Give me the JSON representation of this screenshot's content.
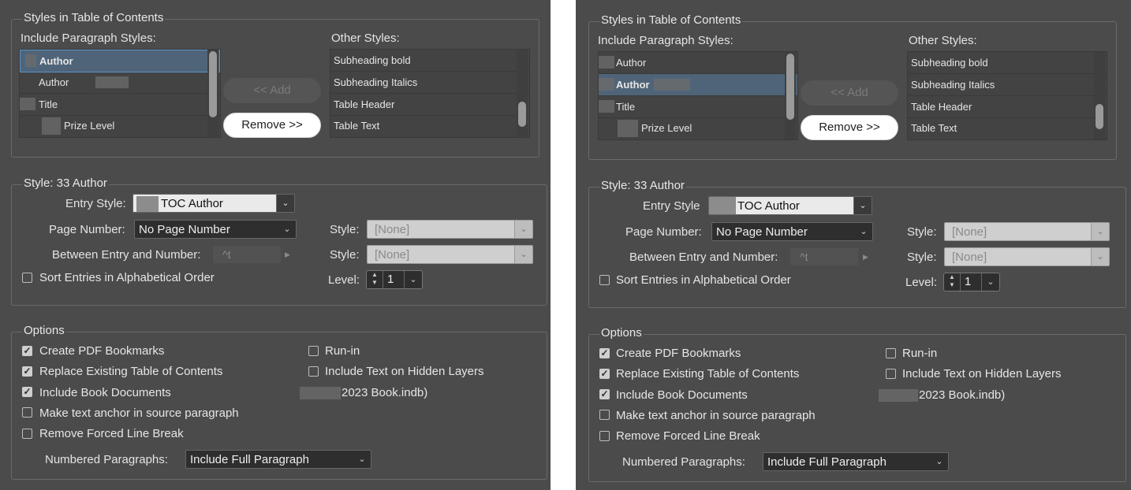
{
  "panels": [
    {
      "styles_in_toc_legend": "Styles in Table of Contents",
      "include_label": "Include Paragraph Styles:",
      "other_label": "Other Styles:",
      "include_items": [
        "Author",
        "Author",
        "Title",
        "Prize Level"
      ],
      "selected_index": 0,
      "other_items": [
        "Subheading bold",
        "Subheading Italics",
        "Table Header",
        "Table Text"
      ],
      "add_label": "<< Add",
      "remove_label": "Remove >>",
      "style_legend": "Style: 33 Author",
      "entry_style_label": "Entry Style:",
      "entry_style_value": "TOC Author",
      "page_number_label": "Page Number:",
      "page_number_value": "No Page Number",
      "between_label": "Between Entry and Number:",
      "between_value": "^t",
      "style_label": "Style:",
      "style_value_1": "[None]",
      "style_value_2": "[None]",
      "sort_label": "Sort Entries in Alphabetical Order",
      "level_label": "Level:",
      "level_value": "1",
      "options_legend": "Options",
      "options": [
        {
          "label": "Create PDF Bookmarks",
          "checked": true
        },
        {
          "label": "Replace Existing Table of Contents",
          "checked": true
        },
        {
          "label": "Include Book Documents",
          "checked": true
        },
        {
          "label": "Make text anchor in source paragraph",
          "checked": false
        },
        {
          "label": "Remove Forced Line Break",
          "checked": false
        }
      ],
      "run_in_label": "Run-in",
      "hidden_layers_label": "Include Text on Hidden Layers",
      "book_file": "2023 Book.indb)",
      "numbered_label": "Numbered Paragraphs:",
      "numbered_value": "Include Full Paragraph"
    },
    {
      "styles_in_toc_legend": "Styles in Table of Contents",
      "include_label": "Include Paragraph Styles:",
      "other_label": "Other Styles:",
      "include_items": [
        "Author",
        "Author",
        "Title",
        "Prize Level"
      ],
      "selected_index": 1,
      "other_items": [
        "Subheading bold",
        "Subheading Italics",
        "Table Header",
        "Table Text"
      ],
      "add_label": "<< Add",
      "remove_label": "Remove >>",
      "style_legend": "Style: 33 Author",
      "entry_style_label": "Entry Style",
      "entry_style_value": "TOC Author",
      "page_number_label": "Page Number:",
      "page_number_value": "No Page Number",
      "between_label": "Between Entry and Number:",
      "between_value": "^t",
      "style_label": "Style:",
      "style_value_1": "[None]",
      "style_value_2": "[None]",
      "sort_label": "Sort Entries in Alphabetical Order",
      "level_label": "Level:",
      "level_value": "1",
      "options_legend": "Options",
      "options": [
        {
          "label": "Create PDF Bookmarks",
          "checked": true
        },
        {
          "label": "Replace Existing Table of Contents",
          "checked": true
        },
        {
          "label": "Include Book Documents",
          "checked": true
        },
        {
          "label": "Make text anchor in source paragraph",
          "checked": false
        },
        {
          "label": "Remove Forced Line Break",
          "checked": false
        }
      ],
      "run_in_label": "Run-in",
      "hidden_layers_label": "Include Text on Hidden Layers",
      "book_file": "2023 Book.indb)",
      "numbered_label": "Numbered Paragraphs:",
      "numbered_value": "Include Full Paragraph"
    }
  ]
}
